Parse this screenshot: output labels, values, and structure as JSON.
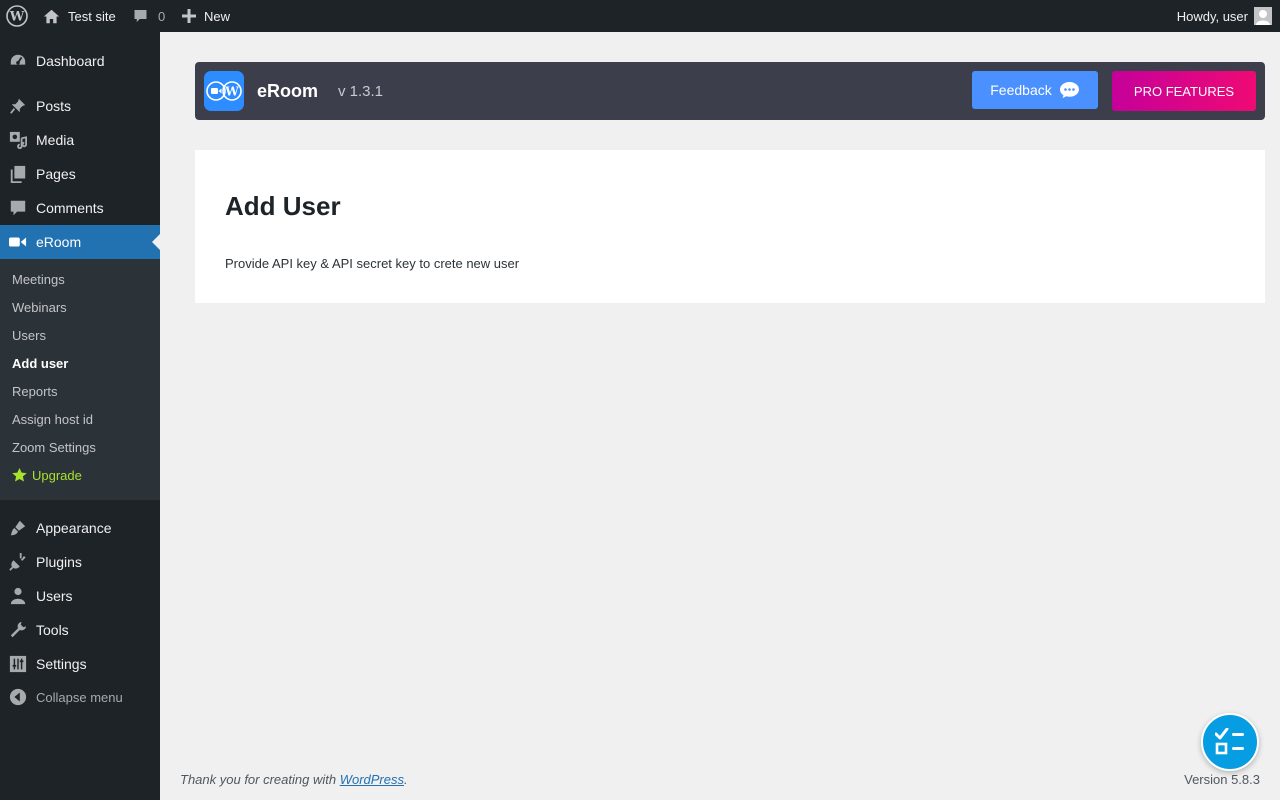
{
  "adminbar": {
    "site_name": "Test site",
    "comments_count": "0",
    "new_label": "New",
    "howdy": "Howdy, user"
  },
  "sidebar": {
    "items": [
      {
        "label": "Dashboard",
        "icon": "dashboard-icon"
      },
      {
        "label": "Posts",
        "icon": "pin-icon"
      },
      {
        "label": "Media",
        "icon": "media-icon"
      },
      {
        "label": "Pages",
        "icon": "pages-icon"
      },
      {
        "label": "Comments",
        "icon": "comment-icon"
      },
      {
        "label": "eRoom",
        "icon": "video-camera-icon",
        "active": true
      },
      {
        "label": "Appearance",
        "icon": "paintbrush-icon"
      },
      {
        "label": "Plugins",
        "icon": "plugin-icon"
      },
      {
        "label": "Users",
        "icon": "user-icon"
      },
      {
        "label": "Tools",
        "icon": "wrench-icon"
      },
      {
        "label": "Settings",
        "icon": "settings-icon"
      }
    ],
    "collapse_label": "Collapse menu",
    "submenu": [
      {
        "label": "Meetings"
      },
      {
        "label": "Webinars"
      },
      {
        "label": "Users"
      },
      {
        "label": "Add user",
        "current": true
      },
      {
        "label": "Reports"
      },
      {
        "label": "Assign host id"
      },
      {
        "label": "Zoom Settings"
      },
      {
        "label": "Upgrade",
        "icon": "star-icon"
      }
    ]
  },
  "header": {
    "plugin_name": "eRoom",
    "version": "v 1.3.1",
    "feedback_label": "Feedback",
    "pro_label": "PRO FEATURES"
  },
  "main": {
    "title": "Add User",
    "description": "Provide API key & API secret key to crete new user"
  },
  "footer": {
    "thanks_prefix": "Thank you for creating with ",
    "wp_link": "WordPress",
    "thanks_suffix": ".",
    "version": "Version 5.8.3"
  },
  "colors": {
    "admin_dark": "#1d2327",
    "active_blue": "#2271b1",
    "feedback_blue": "#4a90ff",
    "pro_magenta": "#e0007f",
    "fab_blue": "#069de3"
  }
}
